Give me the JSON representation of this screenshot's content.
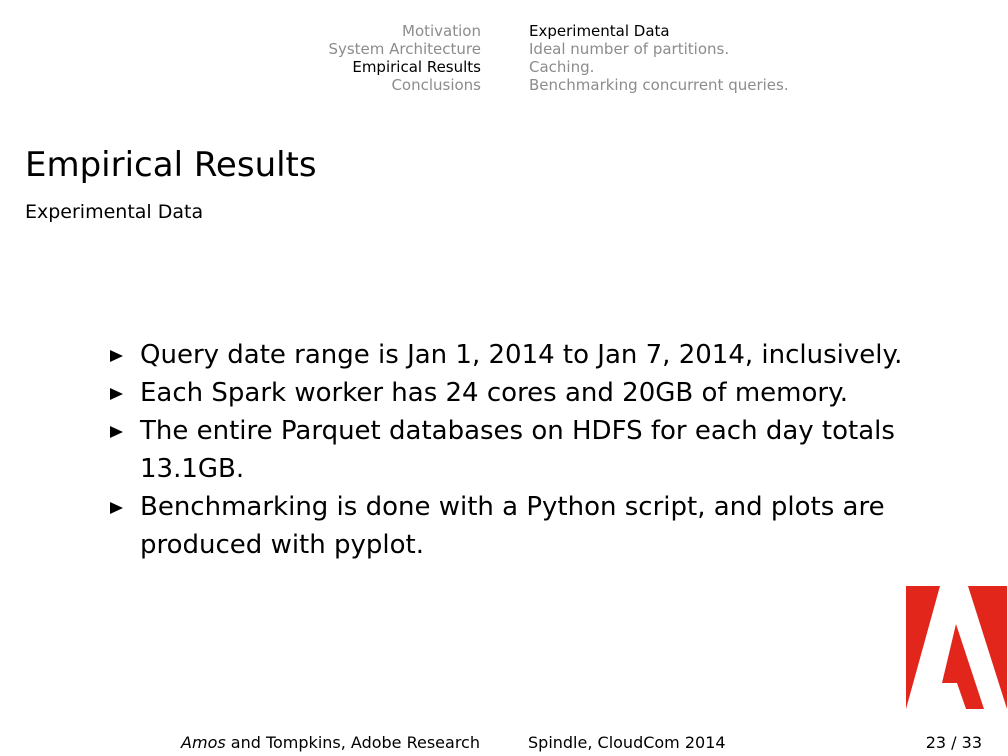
{
  "nav": {
    "sections": [
      "Motivation",
      "System Architecture",
      "Empirical Results",
      "Conclusions"
    ],
    "active_section": "Empirical Results",
    "subsections": [
      "Experimental Data",
      "Ideal number of partitions.",
      "Caching.",
      "Benchmarking concurrent queries."
    ],
    "active_subsection": "Experimental Data"
  },
  "frame": {
    "title": "Empirical Results",
    "subtitle": "Experimental Data"
  },
  "bullets": [
    "Query date range is Jan 1, 2014 to Jan 7, 2014, inclusively.",
    "Each Spark worker has 24 cores and 20GB of memory.",
    "The entire Parquet databases on HDFS for each day totals 13.1GB.",
    "Benchmarking is done with a Python script, and plots are produced with pyplot."
  ],
  "logo": {
    "icon": "adobe-logo-icon",
    "color": "#e3261c"
  },
  "footer": {
    "author_italic": "Amos",
    "author_rest": " and Tompkins, Adobe Research",
    "center": "Spindle, CloudCom 2014",
    "page": "23 / 33"
  },
  "colors": {
    "inactive_nav": "#8c8c8c",
    "text": "#000000"
  }
}
